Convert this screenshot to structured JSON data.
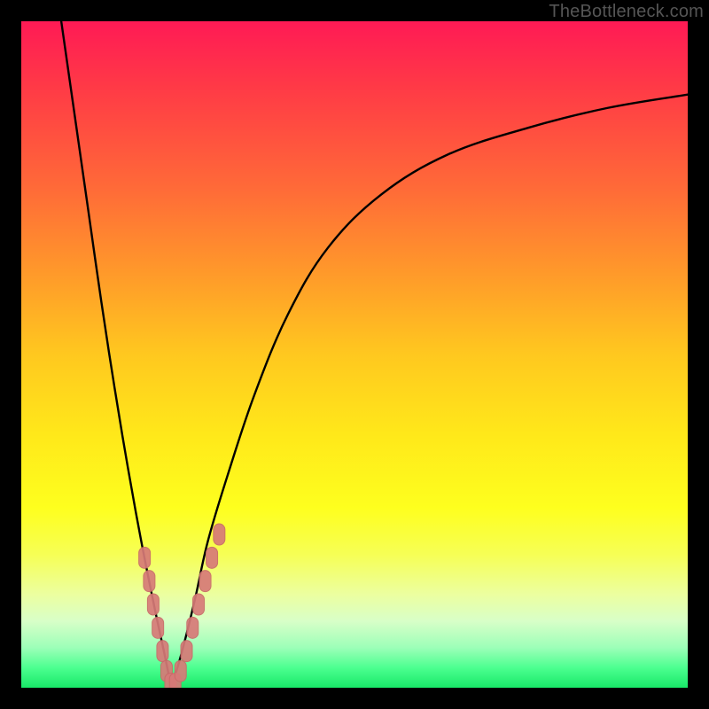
{
  "watermark": "TheBottleneck.com",
  "colors": {
    "frame": "#000000",
    "curve": "#000000",
    "marker_fill": "#d77a78",
    "marker_stroke": "#c86a68",
    "gradient_top": "#ff1a55",
    "gradient_bottom": "#18e868"
  },
  "chart_data": {
    "type": "line",
    "title": "",
    "xlabel": "",
    "ylabel": "",
    "xlim": [
      0,
      100
    ],
    "ylim": [
      0,
      100
    ],
    "grid": false,
    "legend": false,
    "note": "No axis tick labels are rendered in the image; x is a normalized 0–100 horizontal position and y is percent bottleneck (0 at bottom, 100 at top). Values are visually estimated.",
    "series": [
      {
        "name": "left-branch",
        "x": [
          6,
          8,
          10,
          12,
          14,
          16,
          18,
          20,
          21.5,
          22.5
        ],
        "y": [
          100,
          86,
          72,
          58,
          45,
          33,
          22,
          12,
          5,
          0
        ]
      },
      {
        "name": "right-branch",
        "x": [
          22.5,
          24,
          26,
          28,
          31,
          35,
          40,
          46,
          54,
          64,
          76,
          88,
          100
        ],
        "y": [
          0,
          5,
          13,
          22,
          32,
          44,
          56,
          66,
          74,
          80,
          84,
          87,
          89
        ]
      }
    ],
    "markers": {
      "name": "data-points",
      "shape": "rounded-capsule",
      "x": [
        18.5,
        19.2,
        19.8,
        20.5,
        21.2,
        21.8,
        22.4,
        23.1,
        23.9,
        24.8,
        25.7,
        26.6,
        27.6,
        28.6,
        29.7
      ],
      "y": [
        19.5,
        16.0,
        12.5,
        9.0,
        5.5,
        2.5,
        0.6,
        0.6,
        2.5,
        5.5,
        9.0,
        12.5,
        16.0,
        19.5,
        23.0
      ]
    }
  }
}
